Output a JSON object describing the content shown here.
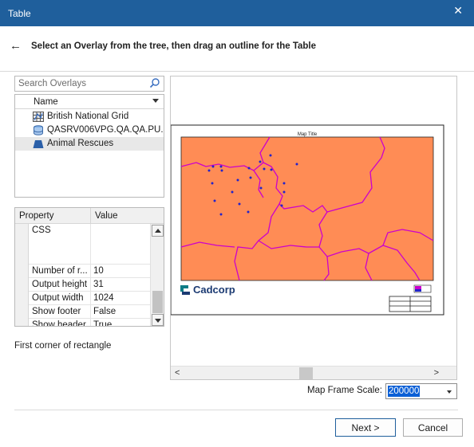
{
  "window": {
    "title": "Table",
    "close_icon": "close-icon"
  },
  "header": {
    "back_icon": "back-arrow-icon",
    "instruction": "Select an Overlay from the tree, then drag an outline for the Table"
  },
  "search": {
    "placeholder": "Search Overlays",
    "icon": "search-icon"
  },
  "tree": {
    "column_header": "Name",
    "items": [
      {
        "label": "British National Grid",
        "icon": "grid-icon",
        "selected": false
      },
      {
        "label": "QASRV006VPG.QA.QA.PU...",
        "icon": "database-icon",
        "selected": false
      },
      {
        "label": "Animal Rescues",
        "icon": "polygon-layer-icon",
        "selected": true
      }
    ]
  },
  "properties": {
    "headers": {
      "property": "Property",
      "value": "Value"
    },
    "rows": [
      {
        "key": "CSS",
        "value": ""
      },
      {
        "key": "Number of r...",
        "value": "10"
      },
      {
        "key": "Output height",
        "value": "31"
      },
      {
        "key": "Output width",
        "value": "1024"
      },
      {
        "key": "Show footer",
        "value": "False"
      },
      {
        "key": "Show header",
        "value": "True"
      }
    ]
  },
  "status_text": "First corner of rectangle",
  "preview": {
    "map_title": "Map Title",
    "logo_text": "Cadcorp",
    "colors": {
      "map_fill": "#ff8c55",
      "boundaries": "#cc00cc",
      "points": "#2222cc"
    }
  },
  "scale": {
    "label": "Map Frame Scale:",
    "value": "200000"
  },
  "buttons": {
    "next": "Next >",
    "cancel": "Cancel"
  }
}
